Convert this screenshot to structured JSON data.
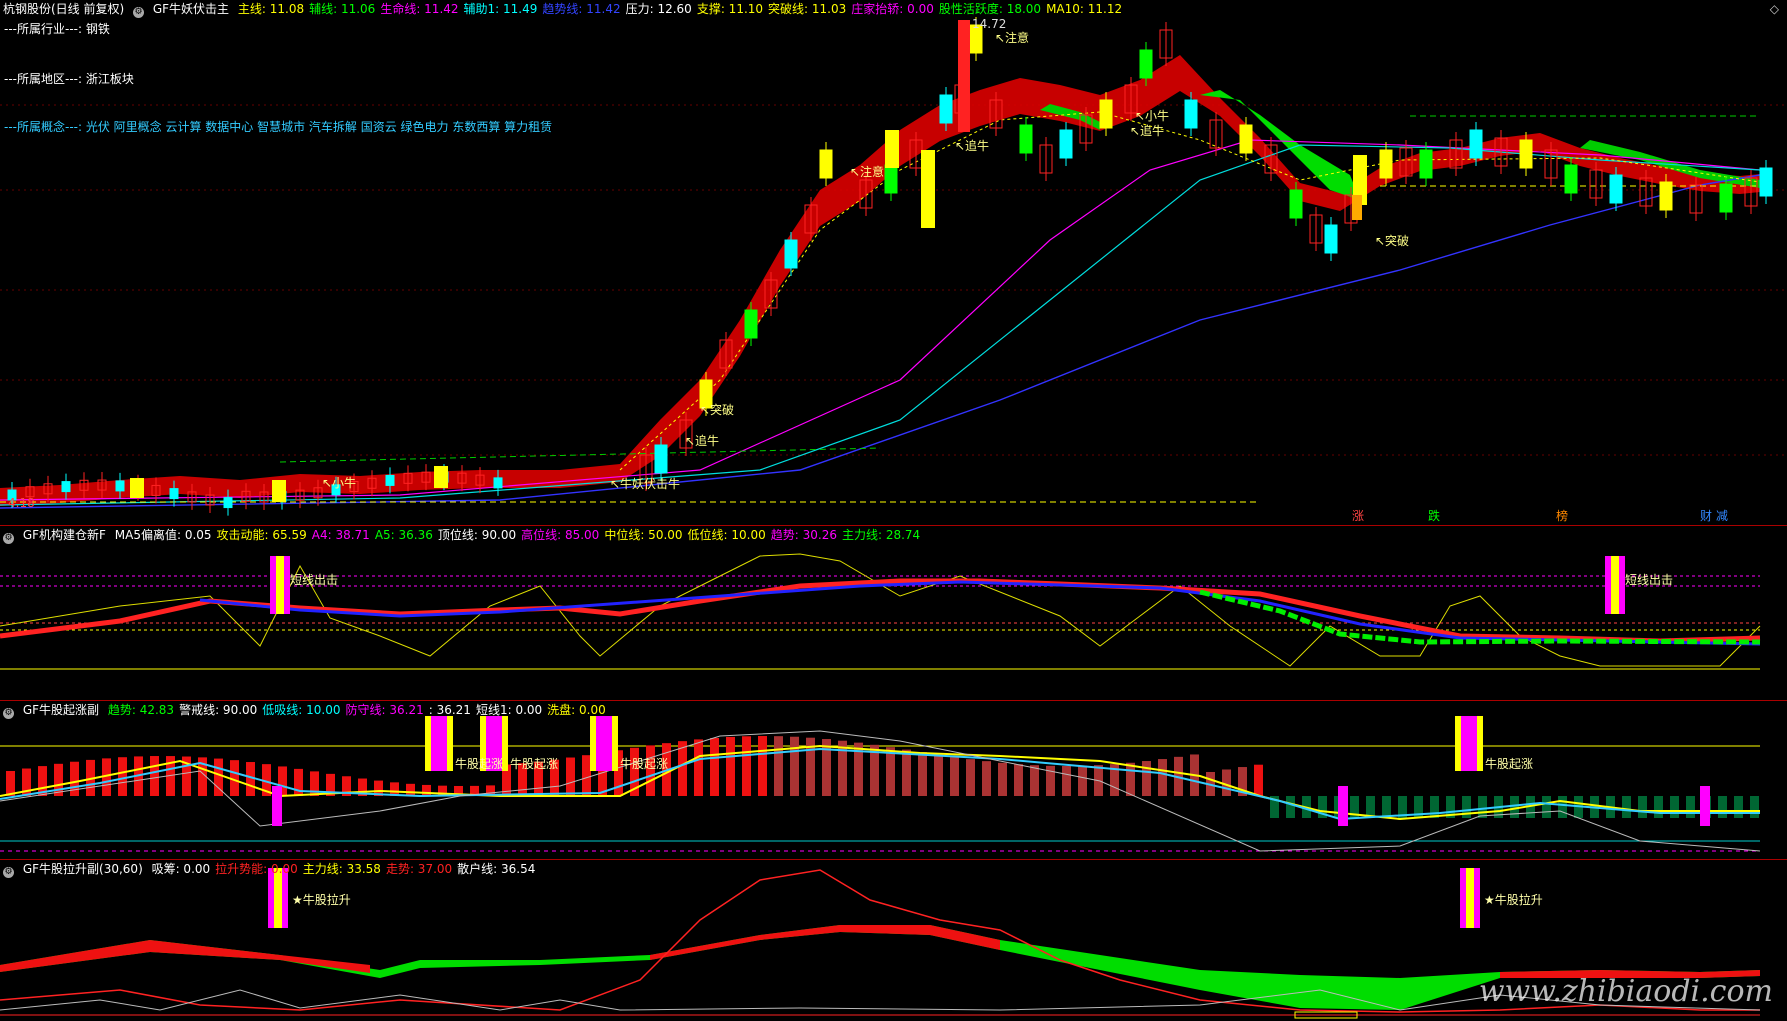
{
  "main": {
    "title": "杭钢股份(日线 前复权)",
    "indicator": "GF牛妖伏击主",
    "params": [
      {
        "label": "主线:",
        "value": "11.08",
        "color": "#ffff00"
      },
      {
        "label": "辅线:",
        "value": "11.06",
        "color": "#00ff00"
      },
      {
        "label": "生命线:",
        "value": "11.42",
        "color": "#ff00ff"
      },
      {
        "label": "辅助1:",
        "value": "11.49",
        "color": "#00ffff"
      },
      {
        "label": "趋势线:",
        "value": "11.42",
        "color": "#3344ff"
      },
      {
        "label": "压力:",
        "value": "12.60",
        "color": "#ffffff"
      },
      {
        "label": "支撑:",
        "value": "11.10",
        "color": "#ffff00"
      },
      {
        "label": "突破线:",
        "value": "11.03",
        "color": "#ffff00"
      },
      {
        "label": "庄家抬轿:",
        "value": "0.00",
        "color": "#ff00ff"
      },
      {
        "label": "股性活跃度:",
        "value": "18.00",
        "color": "#00ff00"
      },
      {
        "label": "MA10:",
        "value": "11.12",
        "color": "#ffff00"
      }
    ],
    "industry": "---所属行业---: 钢铁",
    "region": "---所属地区---: 浙江板块",
    "concepts": "---所属概念---: 光伏 阿里概念 云计算 数据中心 智慧城市 汽车拆解 国资云 绿色电力 东数西算 算力租赁",
    "high_label": "14.72",
    "low_label": "4.18",
    "annotations": [
      "注意",
      "注意",
      "追牛",
      "追牛",
      "突破",
      "突破",
      "小牛",
      "小牛",
      "牛妖伏击牛",
      "追牛"
    ],
    "bottom_tags": [
      "涨",
      "跌",
      "榜",
      "财",
      "减"
    ]
  },
  "p2": {
    "indicator": "GF机构建仓新F",
    "params": [
      {
        "label": "MA5偏离值:",
        "value": "0.05",
        "color": "#ffffff"
      },
      {
        "label": "攻击动能:",
        "value": "65.59",
        "color": "#ffff00"
      },
      {
        "label": "A4:",
        "value": "38.71",
        "color": "#ff00ff"
      },
      {
        "label": "A5:",
        "value": "36.36",
        "color": "#00ff00"
      },
      {
        "label": "顶位线:",
        "value": "90.00",
        "color": "#ffffff"
      },
      {
        "label": "高位线:",
        "value": "85.00",
        "color": "#ff00ff"
      },
      {
        "label": "中位线:",
        "value": "50.00",
        "color": "#ffff00"
      },
      {
        "label": "低位线:",
        "value": "10.00",
        "color": "#ffff00"
      },
      {
        "label": "趋势:",
        "value": "30.26",
        "color": "#ff00ff"
      },
      {
        "label": "主力线:",
        "value": "28.74",
        "color": "#00ff00"
      }
    ],
    "annotations": [
      "短线出击",
      "短线出击"
    ]
  },
  "p3": {
    "indicator": "GF牛股起涨副",
    "params": [
      {
        "label": "趋势:",
        "value": "42.83",
        "color": "#00ff00"
      },
      {
        "label": "警戒线:",
        "value": "90.00",
        "color": "#ffffff"
      },
      {
        "label": "低吸线:",
        "value": "10.00",
        "color": "#00ffff"
      },
      {
        "label": "防守线:",
        "value": "36.21",
        "color": "#ff00ff"
      },
      {
        "label": ":",
        "value": "36.21",
        "color": "#ffffff"
      },
      {
        "label": "短线1:",
        "value": "0.00",
        "color": "#ffffff"
      },
      {
        "label": "洗盘:",
        "value": "0.00",
        "color": "#ffff00"
      }
    ],
    "annotations": [
      "牛股起涨",
      "牛股起涨",
      "牛股起涨",
      "牛股起涨"
    ]
  },
  "p4": {
    "indicator": "GF牛股拉升副(30,60)",
    "params": [
      {
        "label": "吸筹:",
        "value": "0.00",
        "color": "#ffffff"
      },
      {
        "label": "拉升势能:",
        "value": "0.00",
        "color": "#ff2222"
      },
      {
        "label": "主力线:",
        "value": "33.58",
        "color": "#ffff00"
      },
      {
        "label": "走势:",
        "value": "37.00",
        "color": "#ff2222"
      },
      {
        "label": "散户线:",
        "value": "36.54",
        "color": "#ffffff"
      }
    ],
    "annotations": [
      "牛股拉升",
      "牛股拉升"
    ]
  },
  "watermark": "www.zhibiaodi.com",
  "colors": {
    "up": "#ff2222",
    "down": "#00ffff",
    "bg": "#000000",
    "separator": "#aa0000"
  }
}
